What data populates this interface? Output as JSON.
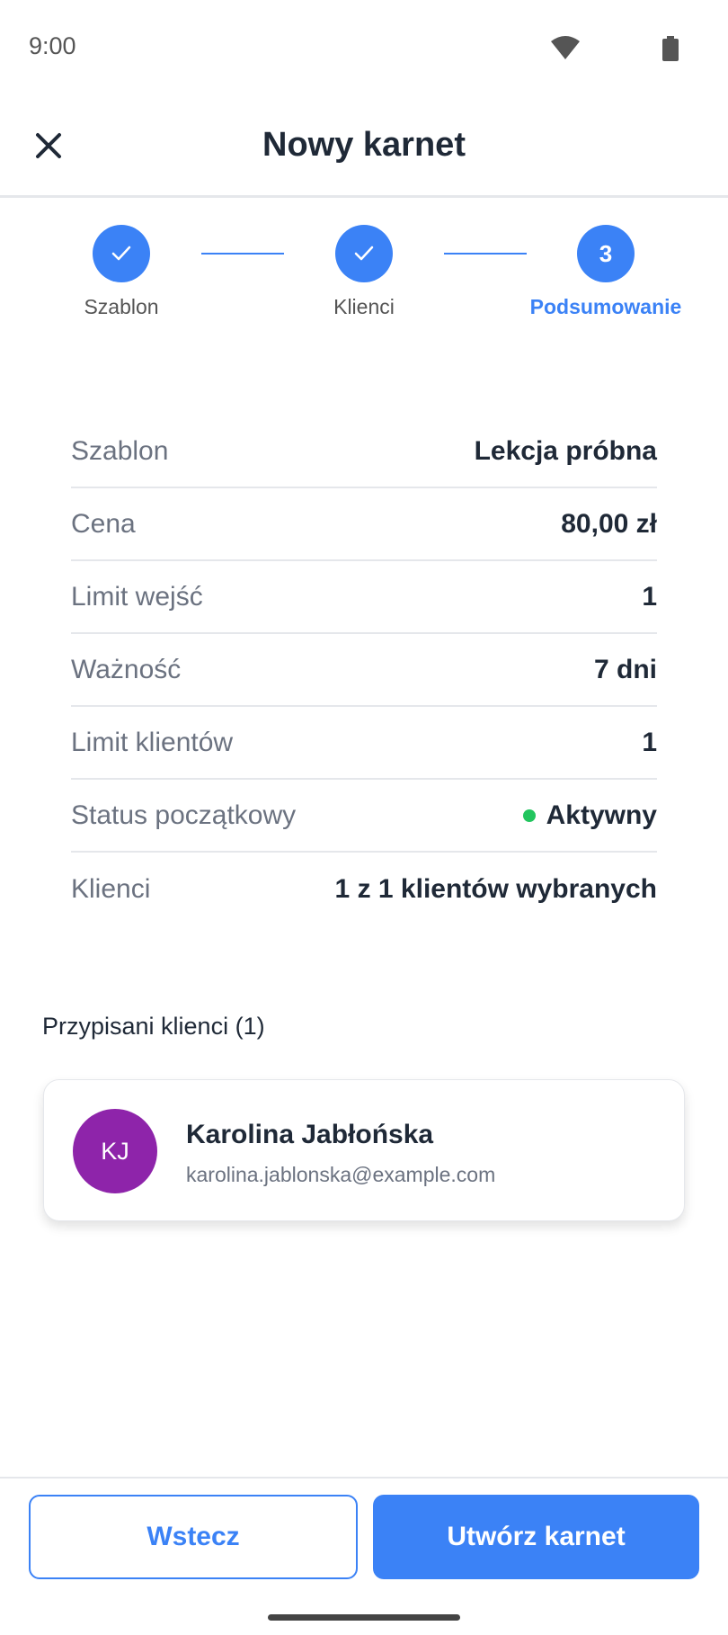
{
  "status_bar": {
    "time": "9:00",
    "wifi_icon": "wifi-icon",
    "battery_icon": "battery-icon"
  },
  "header": {
    "title": "Nowy karnet",
    "close_icon": "close-icon"
  },
  "stepper": {
    "steps": [
      {
        "label": "Szablon",
        "state": "completed",
        "icon": "check-icon"
      },
      {
        "label": "Klienci",
        "state": "completed",
        "icon": "check-icon"
      },
      {
        "label": "Podsumowanie",
        "state": "active",
        "number": "3"
      }
    ]
  },
  "summary": {
    "rows": [
      {
        "label": "Szablon",
        "value": "Lekcja próbna"
      },
      {
        "label": "Cena",
        "value": "80,00 zł"
      },
      {
        "label": "Limit wejść",
        "value": "1"
      },
      {
        "label": "Ważność",
        "value": "7 dni"
      },
      {
        "label": "Limit klientów",
        "value": "1"
      },
      {
        "label": "Status początkowy",
        "value": "Aktywny"
      },
      {
        "label": "Klienci",
        "value": "1 z 1 klientów wybranych"
      }
    ]
  },
  "assigned": {
    "heading": "Przypisani klienci (1)",
    "clients": [
      {
        "initials": "KJ",
        "name": "Karolina Jabłońska",
        "email": "karolina.jablonska@example.com",
        "avatar_color": "#8e24aa"
      }
    ]
  },
  "footer": {
    "back_label": "Wstecz",
    "create_label": "Utwórz karnet"
  },
  "colors": {
    "accent": "#3b82f6",
    "status_active": "#22c55e"
  }
}
